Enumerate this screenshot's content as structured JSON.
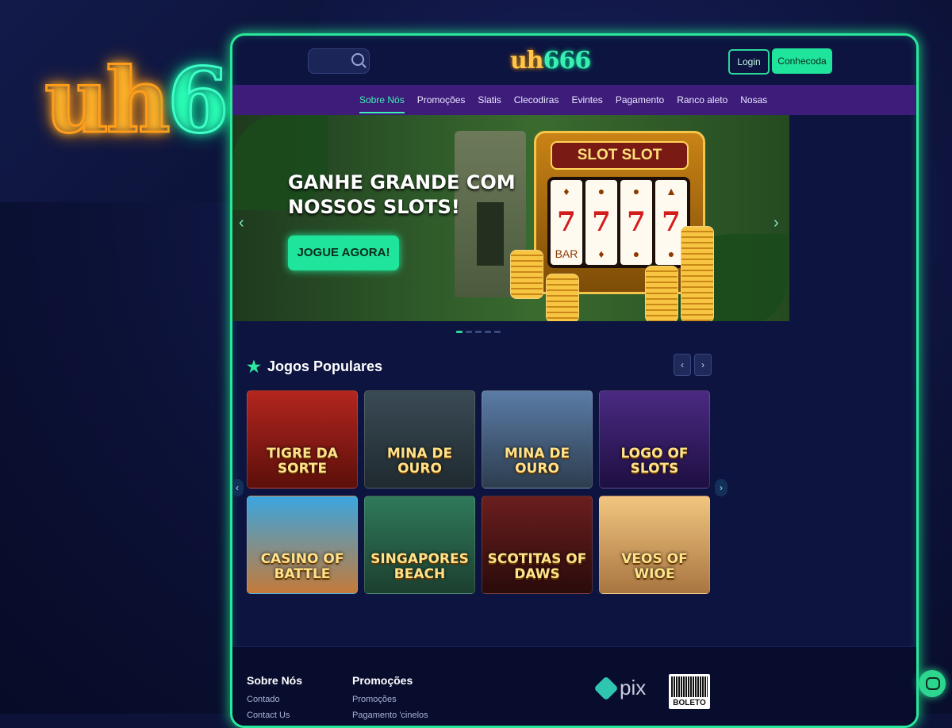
{
  "brand": {
    "logo_uh": "uh",
    "logo_num": "666"
  },
  "header": {
    "search_placeholder": "",
    "login_label": "Login",
    "register_label": "Conhecoda"
  },
  "nav": {
    "items": [
      {
        "label": "Sobre Nós",
        "active": true
      },
      {
        "label": "Promoções"
      },
      {
        "label": "Slatis"
      },
      {
        "label": "Clecodiras"
      },
      {
        "label": "Evintes"
      },
      {
        "label": "Pagamento"
      },
      {
        "label": "Ranco aleto"
      },
      {
        "label": "Nosas"
      }
    ]
  },
  "banner": {
    "headline_line1": "GANHE GRANDE COM",
    "headline_line2": "NOSSOS SLOTS!",
    "cta_label": "JOGUE AGORA!",
    "machine_sign": "SLOT SLOT",
    "reels": [
      "7",
      "7",
      "7",
      "7"
    ],
    "bar_label": "BAR"
  },
  "games": {
    "section_title": "Jogos Populares",
    "prev_label": "‹",
    "next_label": "›",
    "items": [
      {
        "title": "TIGRE DA SORTE"
      },
      {
        "title": "MINA DE OURO"
      },
      {
        "title": "MINA DE OURO"
      },
      {
        "title": "LOGO OF SLOTS"
      },
      {
        "title": "CASINO OF BATTLE"
      },
      {
        "title": "SINGAPORES BEACH"
      },
      {
        "title": "SCOTITAS OF DAWS"
      },
      {
        "title": "VEOS OF WIOE"
      }
    ]
  },
  "footer": {
    "col1": {
      "heading": "Sobre Nós",
      "links": [
        "Contado",
        "Contact Us"
      ]
    },
    "col2": {
      "heading": "Promoções",
      "links": [
        "Promoções",
        "Pagamento 'cinelos"
      ]
    },
    "payments": {
      "pix": "pix",
      "boleto": "BOLETO"
    }
  },
  "colors": {
    "accent": "#1fe49b",
    "nav_bg": "#3e1d7a",
    "bg": "#0c1238"
  }
}
